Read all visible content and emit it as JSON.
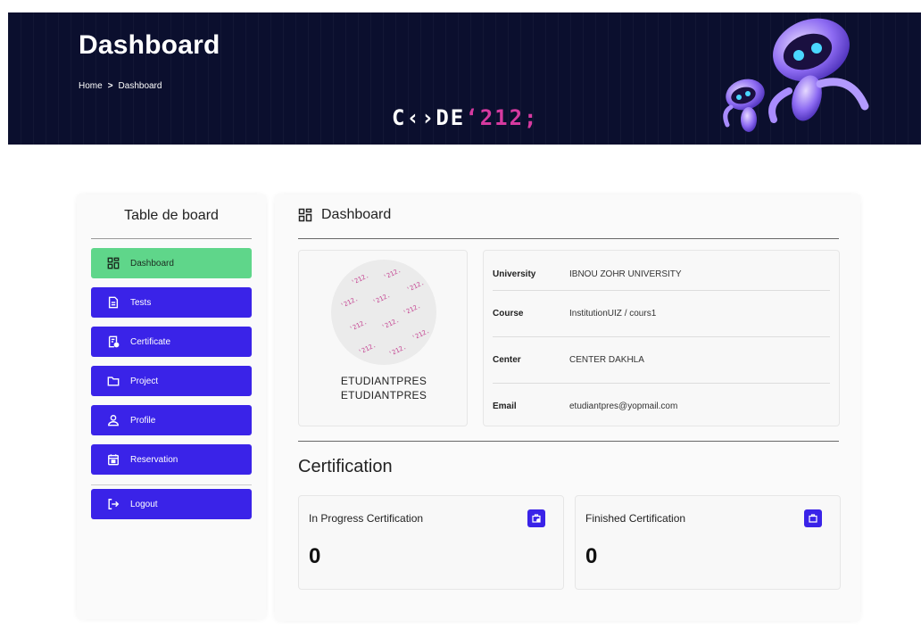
{
  "header": {
    "title": "Dashboard",
    "breadcrumb": {
      "home": "Home",
      "separator": ">",
      "current": "Dashboard"
    },
    "brand": {
      "prefix": "C‹›DE",
      "number": "‘212;"
    }
  },
  "sidebar": {
    "title": "Table de board",
    "items": [
      {
        "label": "Dashboard",
        "icon": "dashboard-icon",
        "active": true
      },
      {
        "label": "Tests",
        "icon": "document-icon"
      },
      {
        "label": "Certificate",
        "icon": "certificate-icon"
      },
      {
        "label": "Project",
        "icon": "folder-icon"
      },
      {
        "label": "Profile",
        "icon": "user-icon"
      },
      {
        "label": "Reservation",
        "icon": "calendar-icon"
      }
    ],
    "logout": {
      "label": "Logout",
      "icon": "logout-icon"
    }
  },
  "main": {
    "title": "Dashboard",
    "profile": {
      "name_line1": "ETUDIANTPRES",
      "name_line2": "ETUDIANTPRES",
      "avatar_pattern_text": "'212."
    },
    "info": [
      {
        "key": "University",
        "value": "IBNOU ZOHR UNIVERSITY"
      },
      {
        "key": "Course",
        "value": "InstitutionUIZ / cours1"
      },
      {
        "key": "Center",
        "value": "CENTER DAKHLA"
      },
      {
        "key": "Email",
        "value": "etudiantpres@yopmail.com"
      }
    ],
    "certification": {
      "title": "Certification",
      "in_progress": {
        "label": "In Progress Certification",
        "count": "0"
      },
      "finished": {
        "label": "Finished Certification",
        "count": "0"
      }
    }
  },
  "colors": {
    "header_bg": "#0b0f2e",
    "primary": "#3a23e8",
    "active": "#5fd68a",
    "brand_accent": "#d63aa0"
  }
}
